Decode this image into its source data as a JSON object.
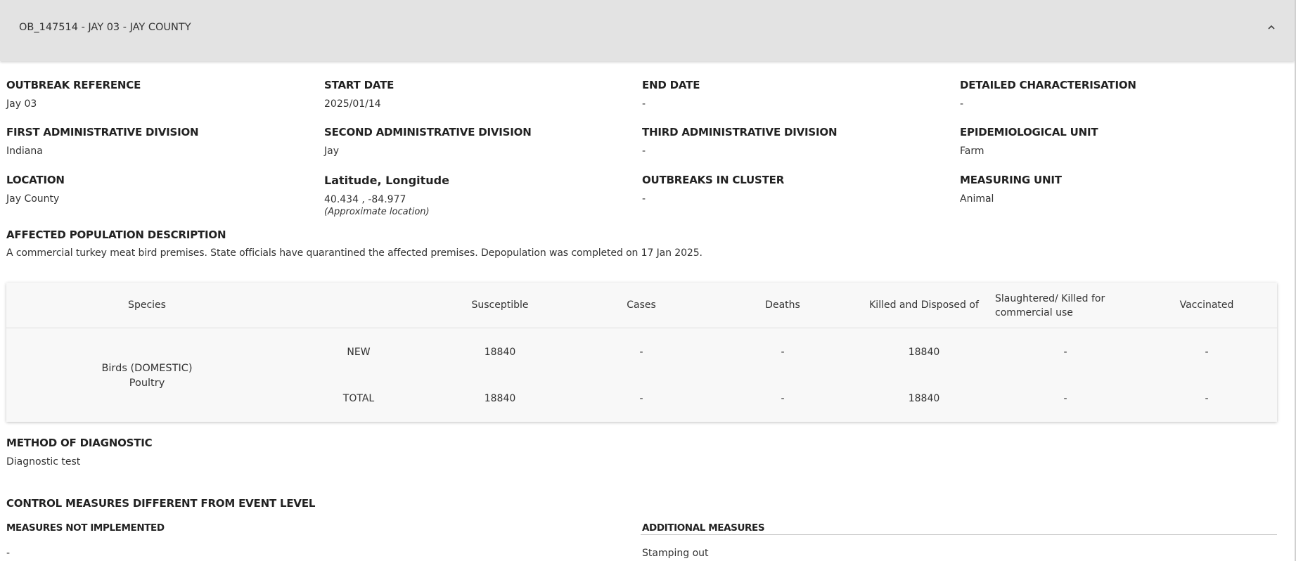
{
  "panel": {
    "title": "OB_147514 - JAY 03 - JAY COUNTY",
    "toggle_icon": "chevron-up-icon"
  },
  "fields": {
    "outbreak_reference": {
      "label": "OUTBREAK REFERENCE",
      "value": "Jay 03"
    },
    "start_date": {
      "label": "START DATE",
      "value": "2025/01/14"
    },
    "end_date": {
      "label": "END DATE",
      "value": "-"
    },
    "detailed_characterisation": {
      "label": "DETAILED CHARACTERISATION",
      "value": "-"
    },
    "first_admin": {
      "label": "FIRST ADMINISTRATIVE DIVISION",
      "value": "Indiana"
    },
    "second_admin": {
      "label": "SECOND ADMINISTRATIVE DIVISION",
      "value": "Jay"
    },
    "third_admin": {
      "label": "THIRD ADMINISTRATIVE DIVISION",
      "value": "-"
    },
    "epi_unit": {
      "label": "EPIDEMIOLOGICAL UNIT",
      "value": "Farm"
    },
    "location": {
      "label": "LOCATION",
      "value": "Jay County"
    },
    "lat_long": {
      "label": "Latitude, Longitude",
      "value": "40.434 , -84.977",
      "note": "(Approximate location)"
    },
    "outbreaks_in_cluster": {
      "label": "OUTBREAKS IN CLUSTER",
      "value": "-"
    },
    "measuring_unit": {
      "label": "MEASURING UNIT",
      "value": "Animal"
    },
    "affected_population": {
      "label": "AFFECTED POPULATION DESCRIPTION",
      "value": "A commercial turkey meat bird premises. State officials have quarantined the affected premises. Depopulation was completed on 17 Jan 2025."
    },
    "method_of_diagnostic": {
      "label": "METHOD OF DIAGNOSTIC",
      "value": "Diagnostic test"
    }
  },
  "species_table": {
    "headers": {
      "species": "Species",
      "susceptible": "Susceptible",
      "cases": "Cases",
      "deaths": "Deaths",
      "killed": "Killed and Disposed of",
      "slaughtered_line1": "Slaughtered/ Killed for",
      "slaughtered_line2": "commercial use",
      "vaccinated": "Vaccinated"
    },
    "species_line1": "Birds (DOMESTIC)",
    "species_line2": "Poultry",
    "rows": [
      {
        "label": "NEW",
        "susceptible": "18840",
        "cases": "-",
        "deaths": "-",
        "killed": "18840",
        "slaughtered": "-",
        "vaccinated": "-"
      },
      {
        "label": "TOTAL",
        "susceptible": "18840",
        "cases": "-",
        "deaths": "-",
        "killed": "18840",
        "slaughtered": "-",
        "vaccinated": "-"
      }
    ]
  },
  "control_measures": {
    "title": "CONTROL MEASURES DIFFERENT FROM EVENT LEVEL",
    "not_implemented_label": "MEASURES NOT IMPLEMENTED",
    "not_implemented_value": "-",
    "additional_label": "ADDITIONAL MEASURES",
    "additional_value": "Stamping out"
  }
}
